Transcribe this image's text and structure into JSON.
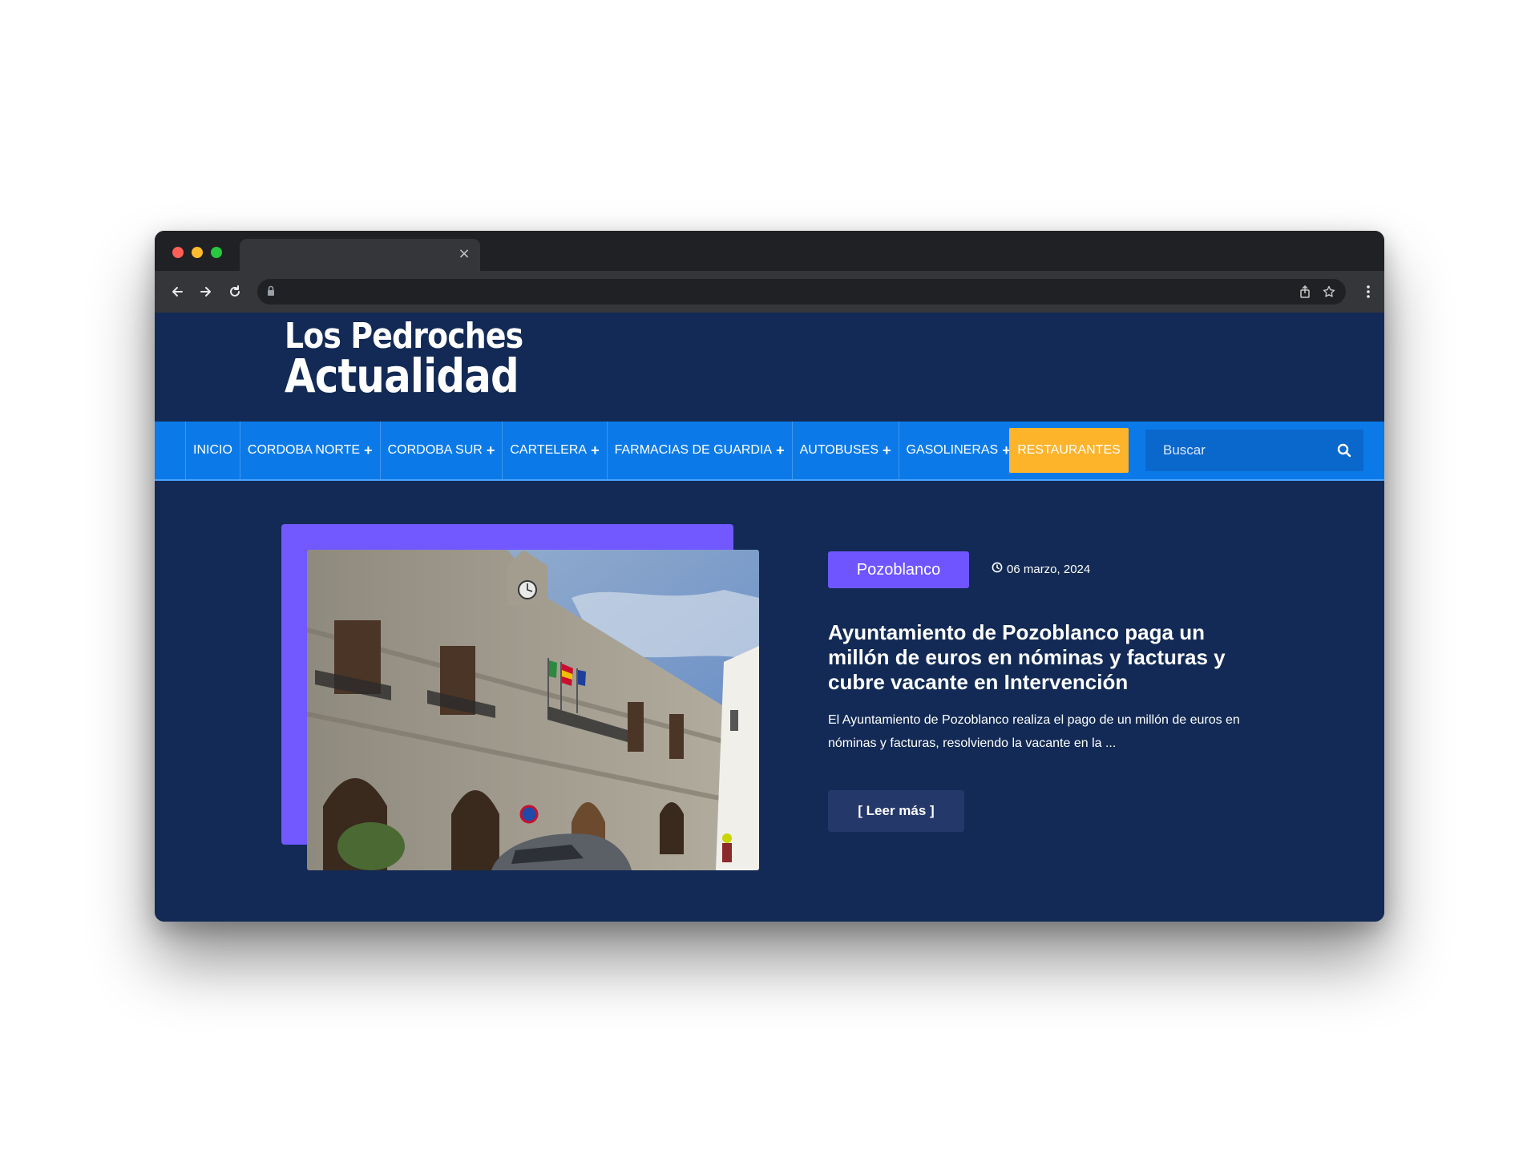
{
  "browser": {
    "tab_close": "×",
    "icons": [
      "back-arrow-icon",
      "forward-arrow-icon",
      "reload-icon",
      "lock-icon",
      "share-icon",
      "star-icon",
      "more-vertical-icon"
    ]
  },
  "site": {
    "logo_line1": "Los Pedroches",
    "logo_line2": "Actualidad"
  },
  "nav": {
    "items": [
      {
        "label": "INICIO",
        "plus": ""
      },
      {
        "label": "CORDOBA NORTE",
        "plus": "+"
      },
      {
        "label": "CORDOBA SUR",
        "plus": "+"
      },
      {
        "label": "CARTELERA",
        "plus": "+"
      },
      {
        "label": "FARMACIAS DE GUARDIA",
        "plus": "+"
      },
      {
        "label": "AUTOBUSES",
        "plus": "+"
      },
      {
        "label": "GASOLINERAS",
        "plus": "+"
      }
    ],
    "highlight": "RESTAURANTES",
    "search_placeholder": "Buscar"
  },
  "article": {
    "category": "Pozoblanco",
    "date": "06 marzo, 2024",
    "title": "Ayuntamiento de Pozoblanco paga un millón de euros en nóminas y facturas y cubre vacante en Intervención",
    "excerpt": "El Ayuntamiento de Pozoblanco realiza el pago de un millón de euros en nóminas y facturas, resolviendo la vacante en la ...",
    "read_more": "[ Leer más ]"
  },
  "colors": {
    "header_bg": "#122a55",
    "nav_bg": "#0b7ae8",
    "accent_orange": "#fdb32a",
    "accent_purple": "#6f55ff",
    "button_bg": "#24386a"
  }
}
